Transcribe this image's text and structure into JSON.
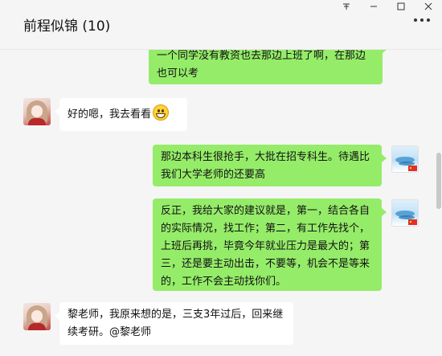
{
  "window": {
    "pin_glyph": "不",
    "minimize_glyph": "—",
    "maximize_glyph": "☐",
    "close_glyph": "✕"
  },
  "header": {
    "title": "前程似锦 (10)",
    "more_icon": "more-dots-icon"
  },
  "messages": [
    {
      "side": "out",
      "text": "一个同学没有教资也去那边上班了啊，在那边也可以考"
    },
    {
      "side": "in",
      "text": "好的嗯，我去看看",
      "emoji": "grin-emoji-icon"
    },
    {
      "side": "out",
      "text": "那边本科生很抢手，大批在招专科生。待遇比我们大学老师的还要高"
    },
    {
      "side": "out",
      "text": "反正，我给大家的建议就是，第一，结合各自的实际情况，找工作；第二，有工作先找个，上班后再挑，毕竟今年就业压力是最大的；第三，还是要主动出击，不要等，机会不是等来的，工作不会主动找你们。"
    },
    {
      "side": "in",
      "text": "黎老师，我原来想的是，三支3年过后，回来继续考研。@黎老师"
    }
  ],
  "colors": {
    "outgoing_bubble": "#95ec69",
    "incoming_bubble": "#ffffff",
    "background": "#f5f5f5"
  }
}
